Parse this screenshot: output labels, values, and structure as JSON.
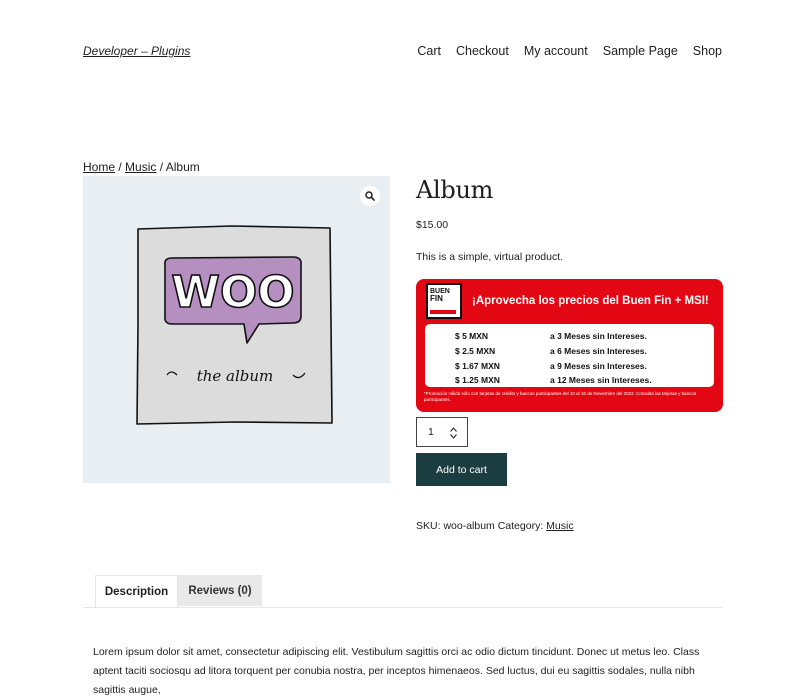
{
  "header": {
    "site_title": "Developer – Plugins",
    "nav": [
      "Cart",
      "Checkout",
      "My account",
      "Sample Page",
      "Shop"
    ]
  },
  "breadcrumb": {
    "items": [
      "Home",
      "Music"
    ],
    "current": "Album",
    "separator": " / "
  },
  "gallery": {
    "zoom_icon": "search-icon",
    "image": {
      "bubble_text": "WOO",
      "caption": "the album"
    }
  },
  "product": {
    "title": "Album",
    "price": "$15.00",
    "short_description": "This is a simple, virtual product."
  },
  "promo": {
    "logo_line1": "BUEN",
    "logo_line2": "FIN",
    "heading": "¡Aprovecha los precios del Buen Fin + MSI!",
    "rows": [
      {
        "amount": "$ 5 MXN",
        "term": "a 3 Meses sin Intereses."
      },
      {
        "amount": "$ 2.5 MXN",
        "term": "a 6 Meses sin Intereses."
      },
      {
        "amount": "$ 1.67 MXN",
        "term": "a 9 Meses sin Intereses."
      },
      {
        "amount": "$ 1.25 MXN",
        "term": "a 12 Meses sin Intereses."
      }
    ],
    "footnote": "*Promoción válida sólo con tarjetas de crédito y bancos participantes del 10 al 16 de Noviembre del 2022. Consulta las tarjetas y bancos participantes.",
    "colors": {
      "background": "#e30613",
      "text": "#ffffff"
    }
  },
  "cart": {
    "quantity": "1",
    "add_to_cart_label": "Add to cart",
    "button_color": "#1b3c40"
  },
  "meta": {
    "sku_label": "SKU:",
    "sku": "woo-album",
    "category_label": "Category:",
    "category": "Music"
  },
  "tabs": {
    "items": [
      "Description",
      "Reviews (0)"
    ],
    "active": "Description"
  },
  "description": {
    "text": "Lorem ipsum dolor sit amet, consectetur adipiscing elit. Vestibulum sagittis orci ac odio dictum tincidunt. Donec ut metus leo. Class aptent taciti sociosqu ad litora torquent per conubia nostra, per inceptos himenaeos. Sed luctus, dui eu sagittis sodales, nulla nibh sagittis augue,"
  }
}
